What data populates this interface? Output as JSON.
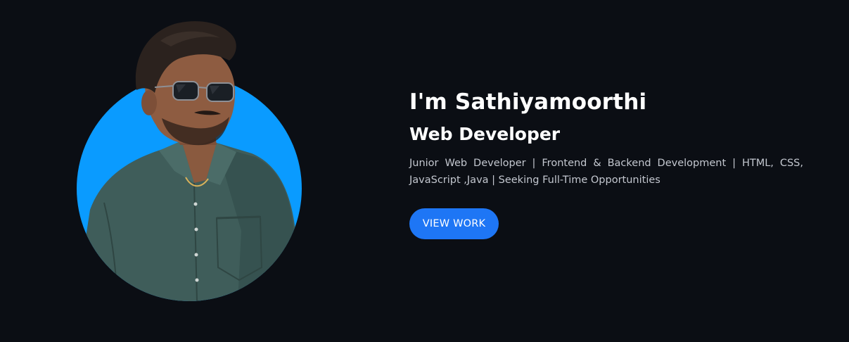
{
  "hero": {
    "heading": "I'm Sathiyamoorthi",
    "subheading": "Web Developer",
    "description": "Junior Web Developer | Frontend & Backend Development | HTML, CSS, JavaScript ,Java | Seeking Full-Time Opportunities",
    "cta_label": "VIEW WORK"
  },
  "portrait": {
    "icon": "profile-photo",
    "circle_color": "#0a9bff"
  },
  "colors": {
    "background": "#0b0e14",
    "button": "#1e76f5",
    "text_primary": "#ffffff",
    "text_secondary": "#c3c7cf"
  }
}
